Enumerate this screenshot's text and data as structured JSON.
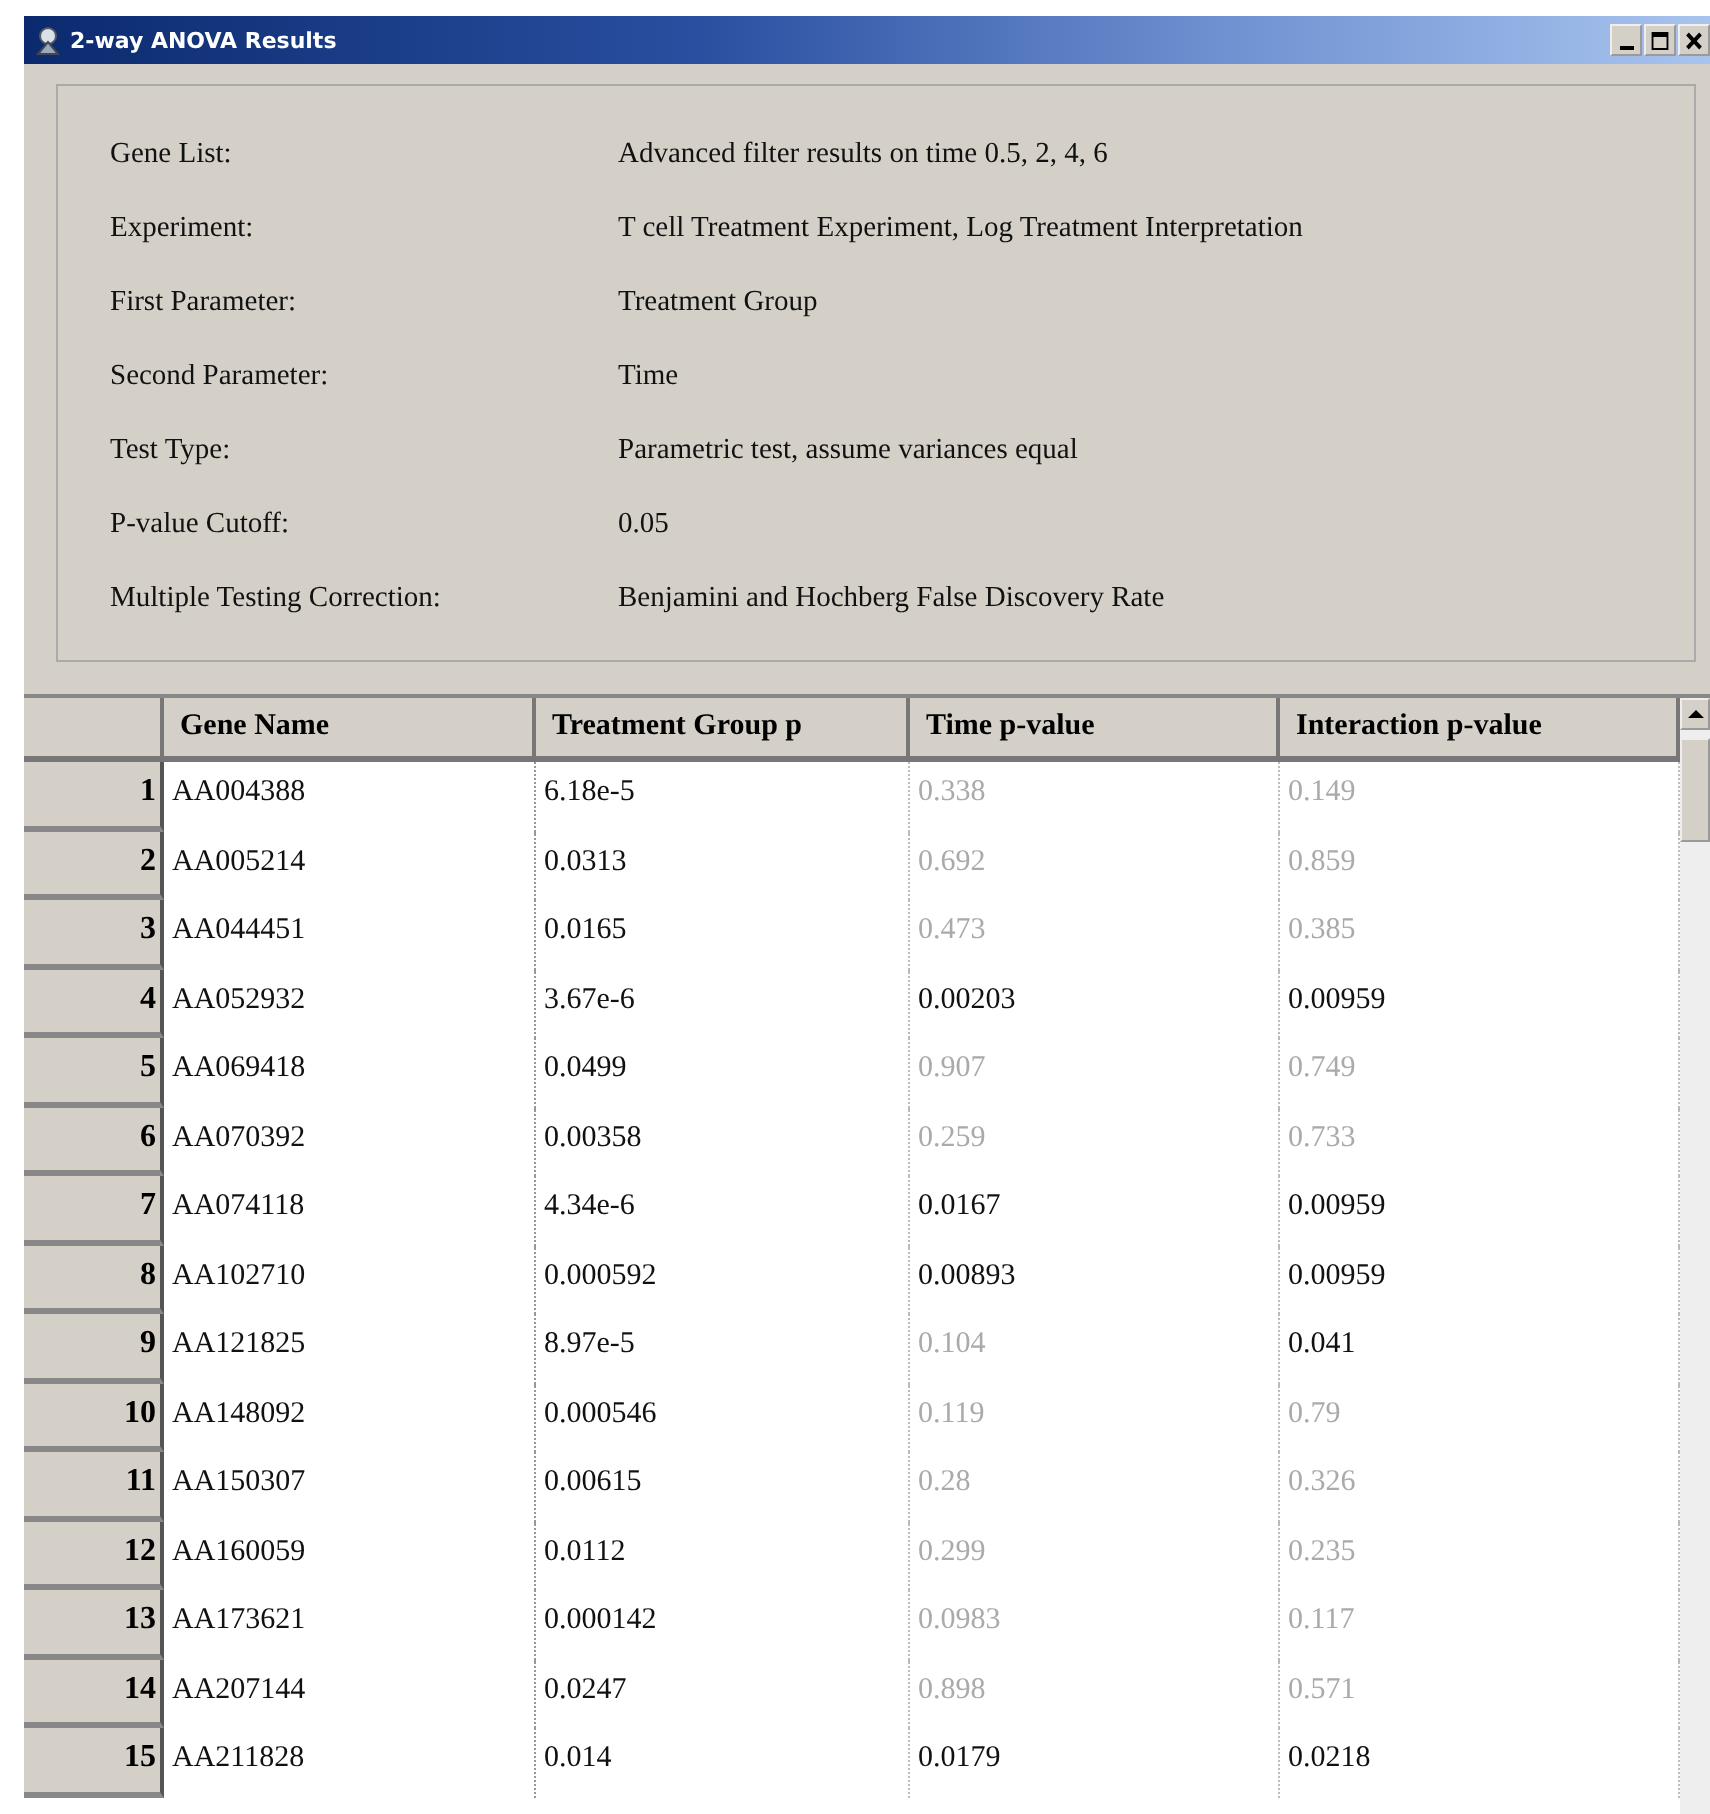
{
  "window": {
    "title": "2-way ANOVA Results"
  },
  "summary": [
    {
      "label": "Gene List:",
      "value": "Advanced filter results on time 0.5, 2, 4, 6"
    },
    {
      "label": "Experiment:",
      "value": "T cell Treatment Experiment, Log Treatment Interpretation"
    },
    {
      "label": "First Parameter:",
      "value": "Treatment Group"
    },
    {
      "label": "Second Parameter:",
      "value": "Time"
    },
    {
      "label": "Test Type:",
      "value": "Parametric test, assume variances equal"
    },
    {
      "label": "P-value Cutoff:",
      "value": "0.05"
    },
    {
      "label": "Multiple Testing Correction:",
      "value": "Benjamini and Hochberg False Discovery Rate"
    }
  ],
  "table": {
    "columns": [
      "Gene Name",
      "Treatment Group p",
      "Time p-value",
      "Interaction p-value"
    ],
    "rows": [
      {
        "number": "1",
        "cells": [
          {
            "text": "AA004388",
            "faded": false
          },
          {
            "text": "6.18e-5",
            "faded": false
          },
          {
            "text": "0.338",
            "faded": true
          },
          {
            "text": "0.149",
            "faded": true
          }
        ]
      },
      {
        "number": "2",
        "cells": [
          {
            "text": "AA005214",
            "faded": false
          },
          {
            "text": "0.0313",
            "faded": false
          },
          {
            "text": "0.692",
            "faded": true
          },
          {
            "text": "0.859",
            "faded": true
          }
        ]
      },
      {
        "number": "3",
        "cells": [
          {
            "text": "AA044451",
            "faded": false
          },
          {
            "text": "0.0165",
            "faded": false
          },
          {
            "text": "0.473",
            "faded": true
          },
          {
            "text": "0.385",
            "faded": true
          }
        ]
      },
      {
        "number": "4",
        "cells": [
          {
            "text": "AA052932",
            "faded": false
          },
          {
            "text": "3.67e-6",
            "faded": false
          },
          {
            "text": "0.00203",
            "faded": false
          },
          {
            "text": "0.00959",
            "faded": false
          }
        ]
      },
      {
        "number": "5",
        "cells": [
          {
            "text": "AA069418",
            "faded": false
          },
          {
            "text": "0.0499",
            "faded": false
          },
          {
            "text": "0.907",
            "faded": true
          },
          {
            "text": "0.749",
            "faded": true
          }
        ]
      },
      {
        "number": "6",
        "cells": [
          {
            "text": "AA070392",
            "faded": false
          },
          {
            "text": "0.00358",
            "faded": false
          },
          {
            "text": "0.259",
            "faded": true
          },
          {
            "text": "0.733",
            "faded": true
          }
        ]
      },
      {
        "number": "7",
        "cells": [
          {
            "text": "AA074118",
            "faded": false
          },
          {
            "text": "4.34e-6",
            "faded": false
          },
          {
            "text": "0.0167",
            "faded": false
          },
          {
            "text": "0.00959",
            "faded": false
          }
        ]
      },
      {
        "number": "8",
        "cells": [
          {
            "text": "AA102710",
            "faded": false
          },
          {
            "text": "0.000592",
            "faded": false
          },
          {
            "text": "0.00893",
            "faded": false
          },
          {
            "text": "0.00959",
            "faded": false
          }
        ]
      },
      {
        "number": "9",
        "cells": [
          {
            "text": "AA121825",
            "faded": false
          },
          {
            "text": "8.97e-5",
            "faded": false
          },
          {
            "text": "0.104",
            "faded": true
          },
          {
            "text": "0.041",
            "faded": false
          }
        ]
      },
      {
        "number": "10",
        "cells": [
          {
            "text": "AA148092",
            "faded": false
          },
          {
            "text": "0.000546",
            "faded": false
          },
          {
            "text": "0.119",
            "faded": true
          },
          {
            "text": "0.79",
            "faded": true
          }
        ]
      },
      {
        "number": "11",
        "cells": [
          {
            "text": "AA150307",
            "faded": false
          },
          {
            "text": "0.00615",
            "faded": false
          },
          {
            "text": "0.28",
            "faded": true
          },
          {
            "text": "0.326",
            "faded": true
          }
        ]
      },
      {
        "number": "12",
        "cells": [
          {
            "text": "AA160059",
            "faded": false
          },
          {
            "text": "0.0112",
            "faded": false
          },
          {
            "text": "0.299",
            "faded": true
          },
          {
            "text": "0.235",
            "faded": true
          }
        ]
      },
      {
        "number": "13",
        "cells": [
          {
            "text": "AA173621",
            "faded": false
          },
          {
            "text": "0.000142",
            "faded": false
          },
          {
            "text": "0.0983",
            "faded": true
          },
          {
            "text": "0.117",
            "faded": true
          }
        ]
      },
      {
        "number": "14",
        "cells": [
          {
            "text": "AA207144",
            "faded": false
          },
          {
            "text": "0.0247",
            "faded": false
          },
          {
            "text": "0.898",
            "faded": true
          },
          {
            "text": "0.571",
            "faded": true
          }
        ]
      },
      {
        "number": "15",
        "cells": [
          {
            "text": "AA211828",
            "faded": false
          },
          {
            "text": "0.014",
            "faded": false
          },
          {
            "text": "0.0179",
            "faded": false
          },
          {
            "text": "0.0218",
            "faded": false
          }
        ]
      }
    ]
  }
}
